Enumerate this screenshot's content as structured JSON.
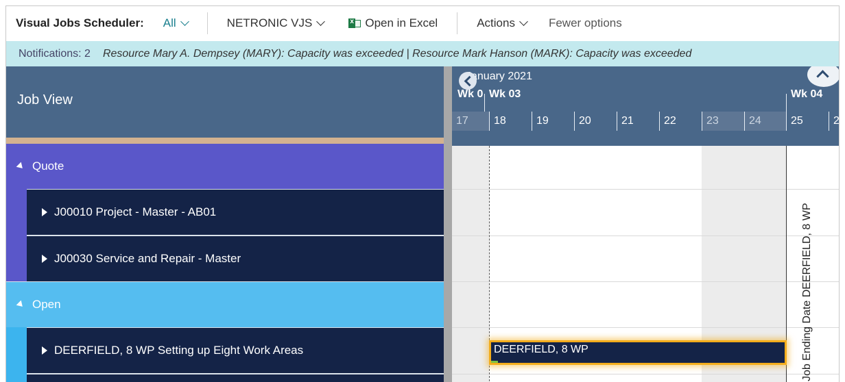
{
  "toolbar": {
    "title": "Visual Jobs Scheduler:",
    "filter_label": "All",
    "netronic_label": "NETRONIC VJS",
    "excel_label": "Open in Excel",
    "actions_label": "Actions",
    "fewer_label": "Fewer options"
  },
  "notifications": {
    "count_label": "Notifications: 2",
    "message": "Resource Mary A. Dempsey (MARY): Capacity was exceeded | Resource Mark Hanson (MARK): Capacity was exceeded"
  },
  "job_view": {
    "title": "Job View",
    "groups": [
      {
        "label": "Quote",
        "color": "#5A57C9"
      },
      {
        "label": "Open",
        "color": "#55BDF0"
      }
    ],
    "jobs": [
      {
        "label": "J00010 Project - Master - AB01"
      },
      {
        "label": "J00030 Service and Repair - Master"
      },
      {
        "label": "DEERFIELD, 8 WP Setting up Eight Work Areas"
      }
    ]
  },
  "timeline": {
    "month": "January 2021",
    "weeks": [
      "Wk 0",
      "Wk 03",
      "Wk 04"
    ],
    "days": [
      "17",
      "18",
      "19",
      "20",
      "21",
      "22",
      "23",
      "24",
      "25",
      "2"
    ],
    "end_marker": "Job Ending Date DEERFIELD, 8 WP",
    "bar_label": "DEERFIELD, 8 WP"
  },
  "colors": {
    "header_bg": "#496789",
    "job_row_bg": "#142347",
    "bar_highlight": "#F3AD1C",
    "notification_bg": "#C3E9EE",
    "accent": "#1A7F8E"
  }
}
